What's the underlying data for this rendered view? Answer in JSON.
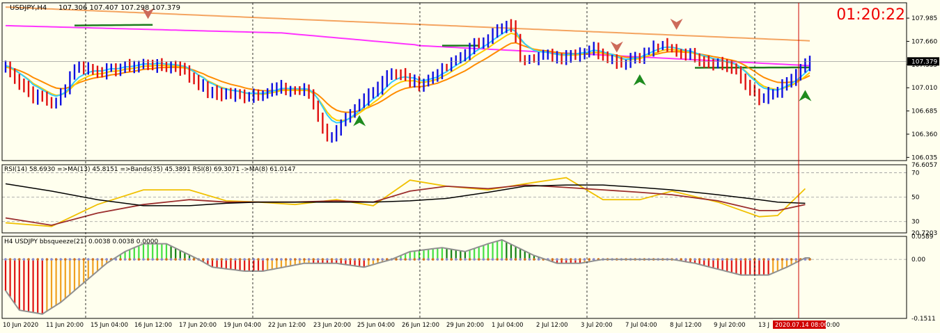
{
  "window": {
    "symbol_label": "USDJPY,H4",
    "ohlc_label": "107.306 107.407 107.298 107.379",
    "countdown": "01:20:22"
  },
  "colors": {
    "background": "#FFFFEE",
    "bull": "#1010E0",
    "bear": "#E01010",
    "ema_fast": "#33CCFF",
    "ema_mid": "#FFCC00",
    "ema_orange": "#FF8C00",
    "ema_slow": "#FF33FF",
    "ma_long": "#F4A460",
    "sma_green": "#1E7B1E",
    "rsi_line": "#F0C000",
    "rsi_ma": "#9B2D2D",
    "rsi_bands": "#000000",
    "hist_red": "#E01010",
    "hist_orange": "#F0A020",
    "hist_darkgreen": "#108010",
    "hist_lime": "#40E040",
    "osc_line": "#909090",
    "cursor_line": "#CC0000",
    "countdown_text": "#EE0000"
  },
  "chart_data": [
    {
      "type": "candlestick",
      "title": "USDJPY,H4",
      "ylim": [
        105.99,
        108.2
      ],
      "price_ticks": [
        "107.985",
        "107.660",
        "107.335",
        "107.010",
        "106.685",
        "106.360",
        "106.035"
      ],
      "current_price": "107.379",
      "x_labels": [
        "10 Jun 2020",
        "11 Jun 20:00",
        "15 Jun 04:00",
        "16 Jun 12:00",
        "17 Jun 20:00",
        "19 Jun 04:00",
        "22 Jun 12:00",
        "23 Jun 20:00",
        "25 Jun 04:00",
        "26 Jun 12:00",
        "29 Jun 20:00",
        "1 Jul 04:00",
        "2 Jul 12:00",
        "3 Jul 20:00",
        "7 Jul 04:00",
        "8 Jul 12:00",
        "9 Jul 20:00",
        "13 J",
        "2020.07.14 08:00",
        "0:00"
      ],
      "cursor_label": "2020.07.14 08:00",
      "indicators": [
        "EMA fast",
        "EMA mid",
        "EMA orange",
        "EMA slow",
        "MA long",
        "SMA green"
      ],
      "arrows": [
        {
          "dir": "down",
          "bar": 31,
          "price": 108.05
        },
        {
          "dir": "up",
          "bar": 77,
          "price": 106.55
        },
        {
          "dir": "down",
          "bar": 133,
          "price": 107.58
        },
        {
          "dir": "up",
          "bar": 138,
          "price": 107.12
        },
        {
          "dir": "down",
          "bar": 146,
          "price": 107.9
        },
        {
          "dir": "up",
          "bar": 174,
          "price": 106.9
        }
      ]
    },
    {
      "type": "line",
      "title": "RSI(14) 58.6930 =>MA(13) 45.8151 =>Bands(35) 45.3891 RSI(8) 69.3071 ->MA(8) 61.0147",
      "ylim": [
        20.7203,
        76.6057
      ],
      "ticks": [
        "76.6057",
        "70",
        "50",
        "30",
        "20.7203"
      ],
      "levels": [
        70,
        50,
        30
      ],
      "series": [
        {
          "name": "RSI(8)",
          "x": [
            0,
            10,
            20,
            30,
            40,
            48,
            55,
            63,
            72,
            80,
            88,
            96,
            105,
            113,
            122,
            130,
            138,
            145,
            155,
            164,
            168,
            174
          ],
          "y": [
            29,
            26,
            44,
            56,
            56,
            47,
            46,
            44,
            48,
            43,
            64,
            59,
            56,
            61,
            66,
            48,
            48,
            55,
            46,
            34,
            35,
            57
          ]
        },
        {
          "name": "MA(13)",
          "x": [
            0,
            10,
            20,
            30,
            40,
            48,
            55,
            63,
            72,
            80,
            88,
            96,
            105,
            113,
            122,
            130,
            138,
            145,
            155,
            164,
            168,
            174
          ],
          "y": [
            33,
            27,
            37,
            44,
            48,
            46,
            46,
            46,
            47,
            46,
            55,
            59,
            57,
            60,
            58,
            56,
            54,
            52,
            47,
            39,
            39,
            44
          ]
        },
        {
          "name": "Bands(35)",
          "x": [
            0,
            10,
            20,
            30,
            40,
            48,
            55,
            63,
            72,
            80,
            88,
            96,
            105,
            113,
            122,
            130,
            138,
            145,
            155,
            164,
            168,
            174
          ],
          "y": [
            61,
            55,
            48,
            43,
            43,
            45,
            46,
            46,
            46,
            46,
            47,
            49,
            54,
            59,
            60,
            60,
            58,
            56,
            52,
            48,
            46,
            45
          ]
        }
      ]
    },
    {
      "type": "histogram",
      "title": "H4 USDJPY bbsqueeze(21) 0.0038 0.0038 0.0000",
      "ylim": [
        -0.1511,
        0.0589
      ],
      "ticks": [
        "0.0589",
        "0.00",
        "-0.1511"
      ],
      "x": [
        0,
        3,
        8,
        12,
        18,
        22,
        26,
        30,
        35,
        42,
        45,
        52,
        56,
        65,
        72,
        78,
        84,
        88,
        95,
        100,
        105,
        108,
        115,
        120,
        125,
        130,
        135,
        140,
        145,
        150,
        160,
        166,
        170,
        174
      ],
      "y": [
        -0.08,
        -0.13,
        -0.14,
        -0.11,
        -0.05,
        -0.01,
        0.02,
        0.04,
        0.04,
        0.0,
        -0.02,
        -0.03,
        -0.03,
        -0.01,
        -0.01,
        -0.02,
        0.0,
        0.02,
        0.03,
        0.02,
        0.04,
        0.05,
        0.01,
        -0.01,
        -0.01,
        0.0,
        0.0,
        0.0,
        0.0,
        -0.01,
        -0.04,
        -0.04,
        -0.02,
        0.0038
      ]
    }
  ]
}
